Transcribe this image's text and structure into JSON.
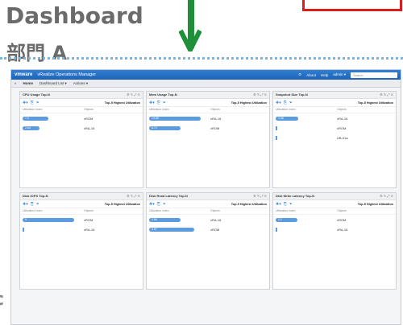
{
  "slide": {
    "title": "Dashboard",
    "subtitle": "部門 A",
    "left_fragment": "c"
  },
  "app": {
    "brand": "vmware",
    "name": "vRealize Operations Manager",
    "topbar": {
      "about": "About",
      "help": "Help",
      "user": "admin ▾",
      "search_placeholder": "Search"
    },
    "nav": {
      "home": "Home",
      "dashboard_list": "Dashboard List ▾",
      "actions": "Actions ▾"
    }
  },
  "widgets": [
    {
      "title": "CPU Usage Top-N",
      "caption": "Top-5 Highest Utilization",
      "col1": "Utilization Index",
      "col2": "Objects",
      "rows": [
        {
          "value": "7.2",
          "object": "vROM",
          "fraction": 0.45
        },
        {
          "value": "2.84",
          "object": "vRA-16",
          "fraction": 0.3
        }
      ]
    },
    {
      "title": "Mem Usage Top-N",
      "caption": "Top-5 Highest Utilization",
      "col1": "Utilization Index",
      "col2": "Objects",
      "rows": [
        {
          "value": "19.89",
          "object": "vRA-16",
          "fraction": 0.92
        },
        {
          "value": "6.72",
          "object": "vROM",
          "fraction": 0.55
        }
      ]
    },
    {
      "title": "Snapshot Size Top-N",
      "caption": "Top-5 Highest Utilization",
      "col1": "Utilization Index",
      "col2": "Objects",
      "rows": [
        {
          "value": "1.56",
          "object": "vRA-16",
          "fraction": 0.4
        },
        {
          "value": "",
          "object": "vROM",
          "fraction": 0
        },
        {
          "value": "",
          "object": "UB-01a",
          "fraction": 0
        }
      ]
    },
    {
      "title": "Disk IOPS Top-N",
      "caption": "Top-5 Highest Utilization",
      "col1": "Utilization Index",
      "col2": "Objects",
      "rows": [
        {
          "value": "5",
          "object": "vROM",
          "fraction": 0.92
        },
        {
          "value": "",
          "object": "vRA-16",
          "fraction": 0
        }
      ]
    },
    {
      "title": "Disk Read Latency Top-N",
      "caption": "Top-5 Highest Utilization",
      "col1": "Utilization Index",
      "col2": "Objects",
      "rows": [
        {
          "value": "0.86",
          "object": "vRA-16",
          "fraction": 0.55
        },
        {
          "value": "0.57",
          "object": "vROM",
          "fraction": 0.8
        }
      ]
    },
    {
      "title": "Disk Write Latency Top-N",
      "caption": "Top-5 Highest Utilization",
      "col1": "Utilization Index",
      "col2": "Objects",
      "rows": [
        {
          "value": "2.2",
          "object": "vROM",
          "fraction": 0.38
        },
        {
          "value": "",
          "object": "vRA-16",
          "fraction": 0
        }
      ]
    }
  ],
  "colors": {
    "accent": "#2f7fd3",
    "bar": "#5b9be0",
    "arrow": "#1f8f3a",
    "frame": "#d91e1e",
    "dotted": "#6fb6e6"
  }
}
